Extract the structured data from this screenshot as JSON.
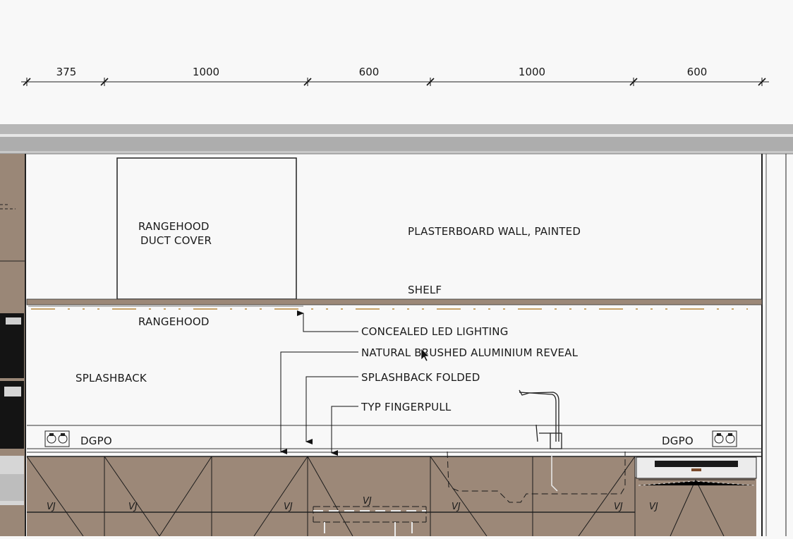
{
  "dimensions": [
    "375",
    "1000",
    "600",
    "1000",
    "600"
  ],
  "labels": {
    "rangehood_cover_1": "RANGEHOOD",
    "rangehood_cover_2": "DUCT COVER",
    "wall": "PLASTERBOARD WALL, PAINTED",
    "shelf": "SHELF",
    "rangehood": "RANGEHOOD",
    "led": "CONCEALED LED LIGHTING",
    "reveal": "NATURAL BRUSHED ALUMINIUM REVEAL",
    "splashback": "SPLASHBACK",
    "splashback_folded": "SPLASHBACK FOLDED",
    "fingerpull": "TYP FINGERPULL",
    "dgpo_left": "DGPO",
    "dgpo_right": "DGPO"
  },
  "cabinet_marks": [
    "VJ",
    "VJ",
    "VJ",
    "VJ",
    "VJ",
    "VJ",
    "VJ"
  ],
  "colors": {
    "timber": "#9c8878",
    "led_strip": "#c9a46a",
    "ceiling_band": "#b4b4b4",
    "appliance_black": "#141414"
  }
}
